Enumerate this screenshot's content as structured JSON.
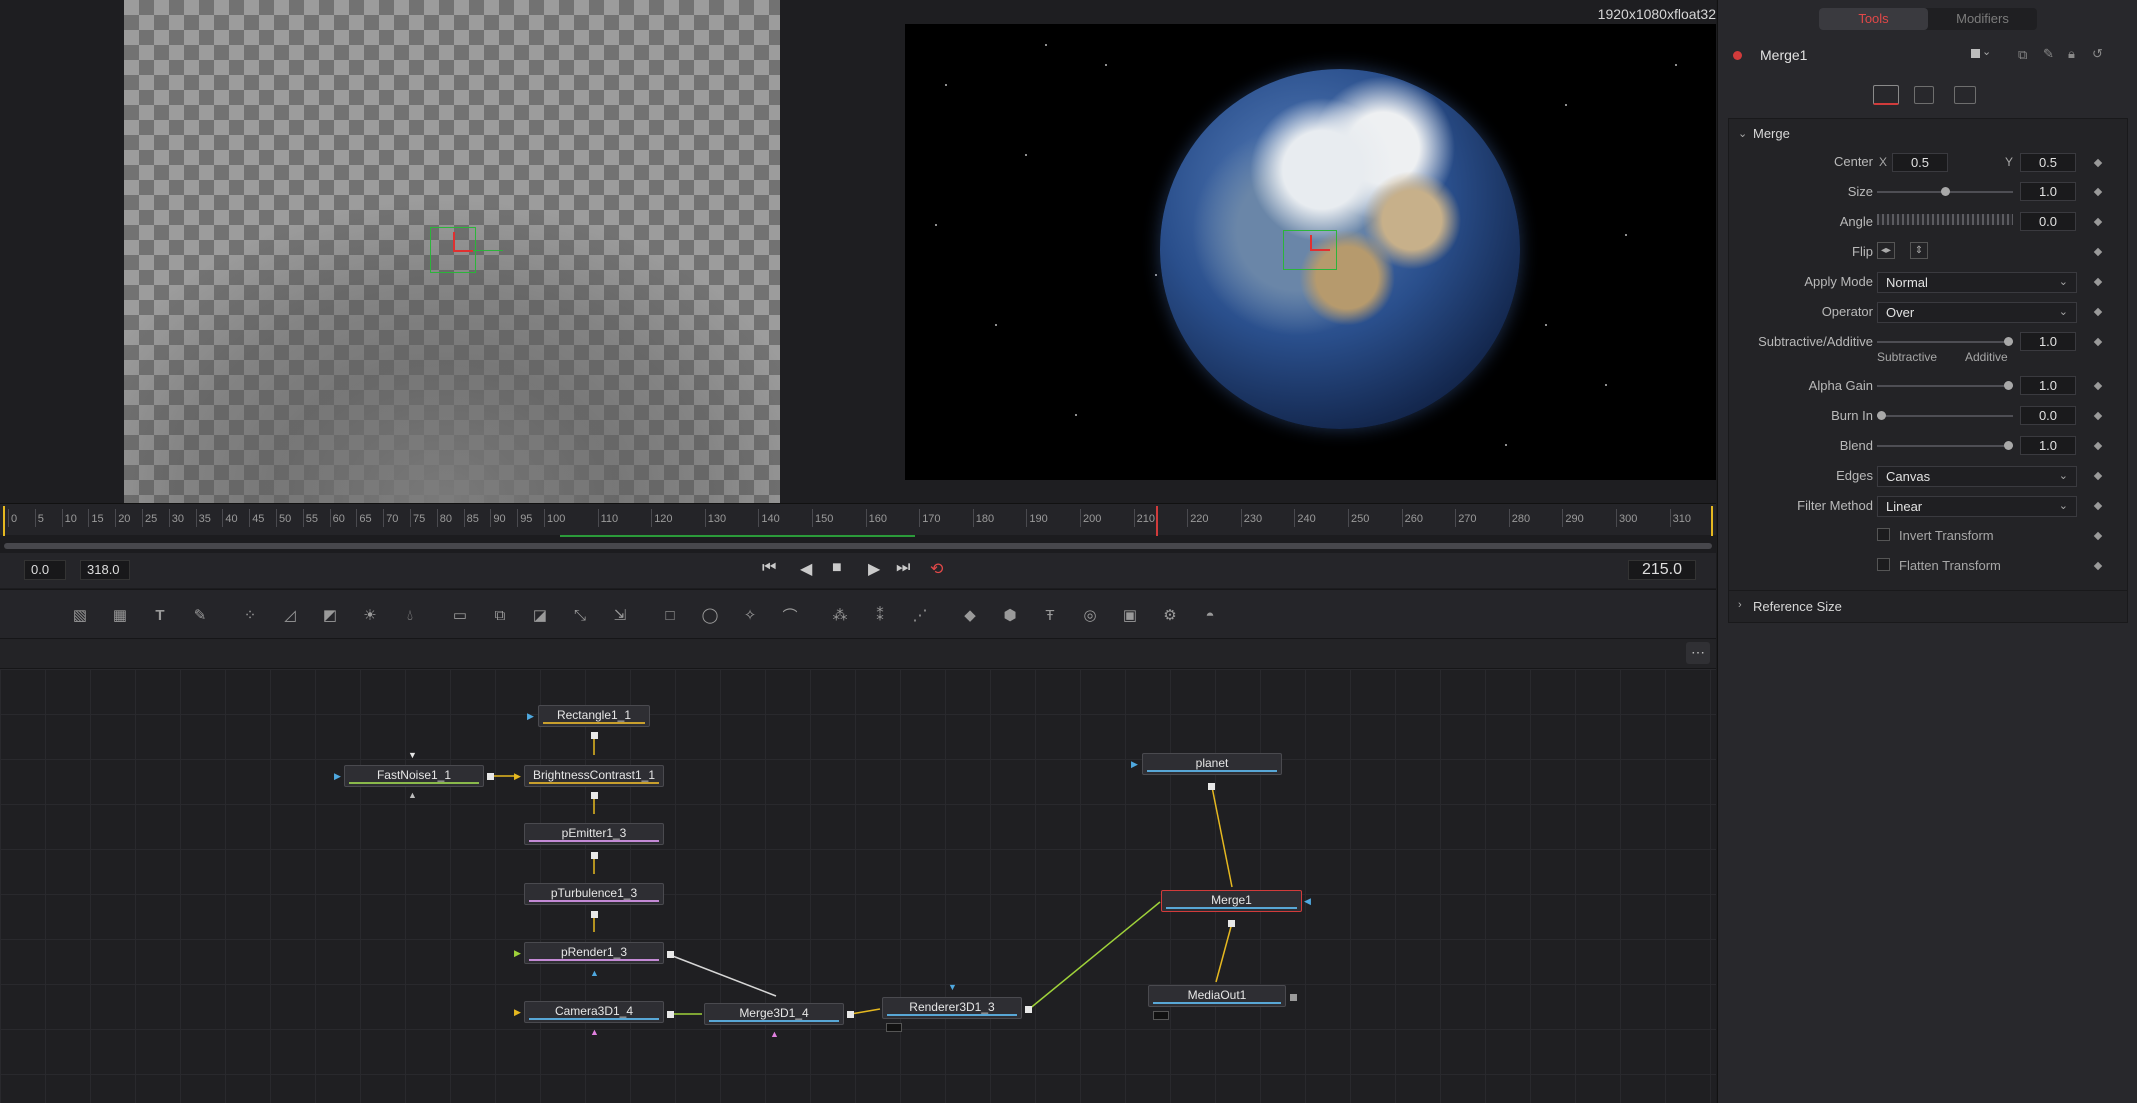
{
  "viewer_right": {
    "format": "1920x1080xfloat32"
  },
  "inspector": {
    "tabs": [
      {
        "label": "Tools"
      },
      {
        "label": "Modifiers"
      }
    ],
    "node_name": "Merge1",
    "section": "Merge",
    "center": {
      "label": "Center",
      "x_label": "X",
      "x_value": "0.5",
      "y_label": "Y",
      "y_value": "0.5"
    },
    "size": {
      "label": "Size",
      "value": "1.0",
      "level": 0.5
    },
    "angle": {
      "label": "Angle",
      "value": "0.0"
    },
    "flip": {
      "label": "Flip"
    },
    "apply_mode": {
      "label": "Apply Mode",
      "value": "Normal"
    },
    "operator": {
      "label": "Operator",
      "value": "Over"
    },
    "sub_add": {
      "label": "Subtractive/Additive",
      "value": "1.0",
      "left": "Subtractive",
      "right": "Additive",
      "level": 1.0
    },
    "alpha_gain": {
      "label": "Alpha Gain",
      "value": "1.0",
      "level": 1.0
    },
    "burn_in": {
      "label": "Burn In",
      "value": "0.0",
      "level": 0.0
    },
    "blend": {
      "label": "Blend",
      "value": "1.0",
      "level": 1.0
    },
    "edges": {
      "label": "Edges",
      "value": "Canvas"
    },
    "filter_method": {
      "label": "Filter Method",
      "value": "Linear"
    },
    "invert_transform": {
      "label": "Invert Transform"
    },
    "flatten_transform": {
      "label": "Flatten Transform"
    },
    "reference_size": {
      "label": "Reference Size"
    }
  },
  "timeline": {
    "ticks": [
      "0",
      "5",
      "10",
      "15",
      "20",
      "25",
      "30",
      "35",
      "40",
      "45",
      "50",
      "55",
      "60",
      "65",
      "70",
      "75",
      "80",
      "85",
      "90",
      "95",
      "100",
      "110",
      "120",
      "130",
      "140",
      "150",
      "160",
      "170",
      "180",
      "190",
      "200",
      "210",
      "220",
      "230",
      "240",
      "250",
      "260",
      "270",
      "280",
      "290",
      "300",
      "310"
    ],
    "start": "0.0",
    "end": "318.0",
    "current": "215.0"
  },
  "nodes": {
    "rectangle": "Rectangle1_1",
    "fastnoise": "FastNoise1_1",
    "brightness": "BrightnessContrast1_1",
    "pemitter": "pEmitter1_3",
    "pturbulence": "pTurbulence1_3",
    "prender": "pRender1_3",
    "camera": "Camera3D1_4",
    "merge3d": "Merge3D1_4",
    "renderer": "Renderer3D1_3",
    "planet": "planet",
    "merge1": "Merge1",
    "mediaout": "MediaOut1"
  },
  "colors": {
    "accent_red": "#d13b3b",
    "tracker_green": "#2bb53a",
    "link_yellow": "#e5b820",
    "link_green": "#9fd23a"
  }
}
